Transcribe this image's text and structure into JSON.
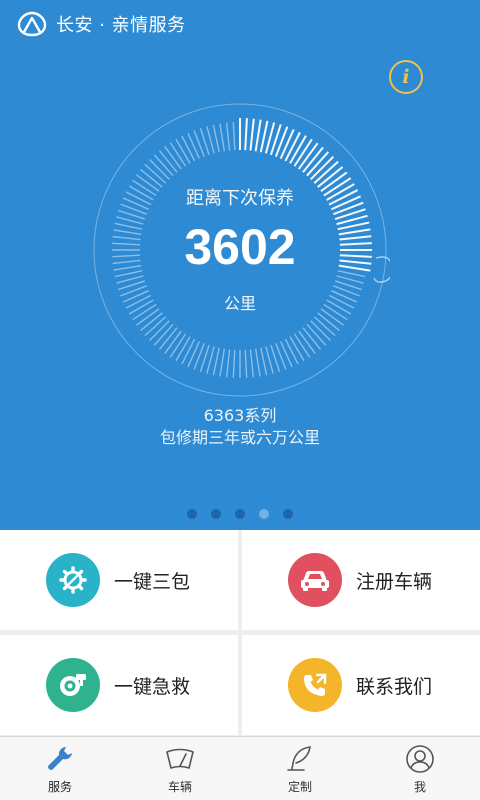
{
  "header": {
    "title": "长安 · 亲情服务"
  },
  "gauge": {
    "label": "距离下次保养",
    "value": "3602",
    "unit": "公里"
  },
  "vehicle": {
    "series": "6363系列",
    "warranty": "包修期三年或六万公里"
  },
  "carousel": {
    "pages": 5,
    "active_index": 3
  },
  "actions": [
    {
      "label": "一键三包",
      "icon": "gear-wrench-icon",
      "color": "#29b3c9"
    },
    {
      "label": "注册车辆",
      "icon": "car-icon",
      "color": "#e0505f"
    },
    {
      "label": "一键急救",
      "icon": "turbo-icon",
      "color": "#2fb38f"
    },
    {
      "label": "联系我们",
      "icon": "phone-icon",
      "color": "#f5b52a"
    }
  ],
  "tabs": [
    {
      "label": "服务",
      "icon": "wrench-icon",
      "active": true
    },
    {
      "label": "车辆",
      "icon": "windshield-icon",
      "active": false
    },
    {
      "label": "定制",
      "icon": "quill-icon",
      "active": false
    },
    {
      "label": "我",
      "icon": "user-icon",
      "active": false
    }
  ],
  "colors": {
    "hero": "#2d8ad3",
    "accent_active": "#3a83c6"
  }
}
